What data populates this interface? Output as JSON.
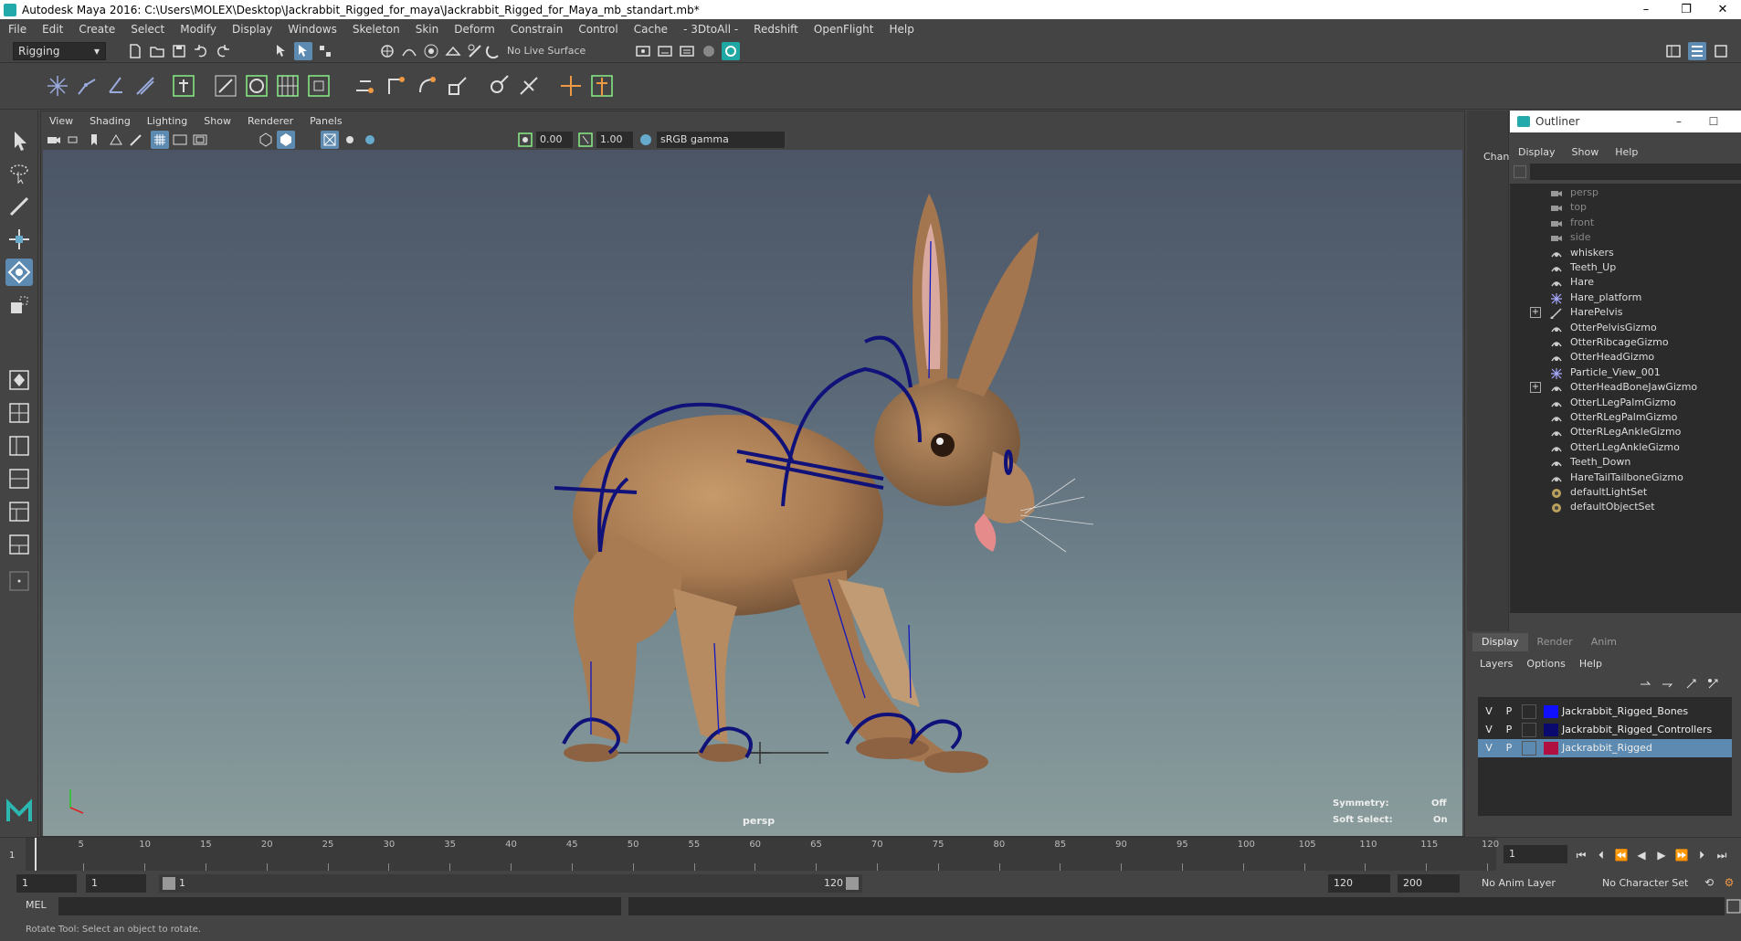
{
  "window": {
    "title": "Autodesk Maya 2016: C:\\Users\\MOLEX\\Desktop\\Jackrabbit_Rigged_for_maya\\Jackrabbit_Rigged_for_Maya_mb_standart.mb*",
    "minimize": "–",
    "restore": "❐",
    "close": "✕"
  },
  "menubar": [
    "File",
    "Edit",
    "Create",
    "Select",
    "Modify",
    "Display",
    "Windows",
    "Skeleton",
    "Skin",
    "Deform",
    "Constrain",
    "Control",
    "Cache",
    "- 3DtoAll -",
    "Redshift",
    "OpenFlight",
    "Help"
  ],
  "statusline": {
    "mode": "Rigging",
    "live_surface": "No Live Surface"
  },
  "viewport": {
    "menus": [
      "View",
      "Shading",
      "Lighting",
      "Show",
      "Renderer",
      "Panels"
    ],
    "exposure": "0.00",
    "gamma": "1.00",
    "color_space": "sRGB gamma",
    "camera_label": "persp",
    "symmetry_label": "Symmetry:",
    "symmetry_value": "Off",
    "soft_select_label": "Soft Select:",
    "soft_select_value": "On"
  },
  "channel_strip": {
    "label": "Chann"
  },
  "outliner": {
    "title": "Outliner",
    "menus": [
      "Display",
      "Show",
      "Help"
    ],
    "items": [
      {
        "label": "persp",
        "type": "camera",
        "dim": true
      },
      {
        "label": "top",
        "type": "camera",
        "dim": true
      },
      {
        "label": "front",
        "type": "camera",
        "dim": true
      },
      {
        "label": "side",
        "type": "camera",
        "dim": true
      },
      {
        "label": "whiskers",
        "type": "mesh"
      },
      {
        "label": "Teeth_Up",
        "type": "mesh"
      },
      {
        "label": "Hare",
        "type": "mesh"
      },
      {
        "label": "Hare_platform",
        "type": "locator"
      },
      {
        "label": "HarePelvis",
        "type": "joint",
        "expandable": true
      },
      {
        "label": "OtterPelvisGizmo",
        "type": "mesh"
      },
      {
        "label": "OtterRibcageGizmo",
        "type": "mesh"
      },
      {
        "label": "OtterHeadGizmo",
        "type": "mesh"
      },
      {
        "label": "Particle_View_001",
        "type": "locator"
      },
      {
        "label": "OtterHeadBoneJawGizmo",
        "type": "mesh",
        "expandable": true
      },
      {
        "label": "OtterLLegPalmGizmo",
        "type": "mesh"
      },
      {
        "label": "OtterRLegPalmGizmo",
        "type": "mesh"
      },
      {
        "label": "OtterRLegAnkleGizmo",
        "type": "mesh"
      },
      {
        "label": "OtterLLegAnkleGizmo",
        "type": "mesh"
      },
      {
        "label": "Teeth_Down",
        "type": "mesh"
      },
      {
        "label": "HareTailTailboneGizmo",
        "type": "mesh"
      },
      {
        "label": "defaultLightSet",
        "type": "set"
      },
      {
        "label": "defaultObjectSet",
        "type": "set"
      }
    ]
  },
  "layers": {
    "tabs": [
      "Display",
      "Render",
      "Anim"
    ],
    "menus": [
      "Layers",
      "Options",
      "Help"
    ],
    "rows": [
      {
        "v": "V",
        "p": "P",
        "color": "#1010ff",
        "name": "Jackrabbit_Rigged_Bones",
        "selected": false
      },
      {
        "v": "V",
        "p": "P",
        "color": "#0a0a6e",
        "name": "Jackrabbit_Rigged_Controllers",
        "selected": false
      },
      {
        "v": "V",
        "p": "P",
        "color": "#b01040",
        "name": "Jackrabbit_Rigged",
        "selected": true
      }
    ]
  },
  "timeline": {
    "ticks": [
      "5",
      "10",
      "15",
      "20",
      "25",
      "30",
      "35",
      "40",
      "45",
      "50",
      "55",
      "60",
      "65",
      "70",
      "75",
      "80",
      "85",
      "90",
      "95",
      "100",
      "105",
      "110",
      "115",
      "120"
    ],
    "first_frame": "1",
    "current_frame": "1"
  },
  "range": {
    "start": "1",
    "playback_start": "1",
    "slider_start": "1",
    "slider_end": "120",
    "playback_end": "120",
    "end": "200",
    "anim_layer": "No Anim Layer",
    "character_set": "No Character Set"
  },
  "cmdline": {
    "lang": "MEL"
  },
  "helpline": {
    "text": "Rotate Tool: Select an object to rotate."
  }
}
